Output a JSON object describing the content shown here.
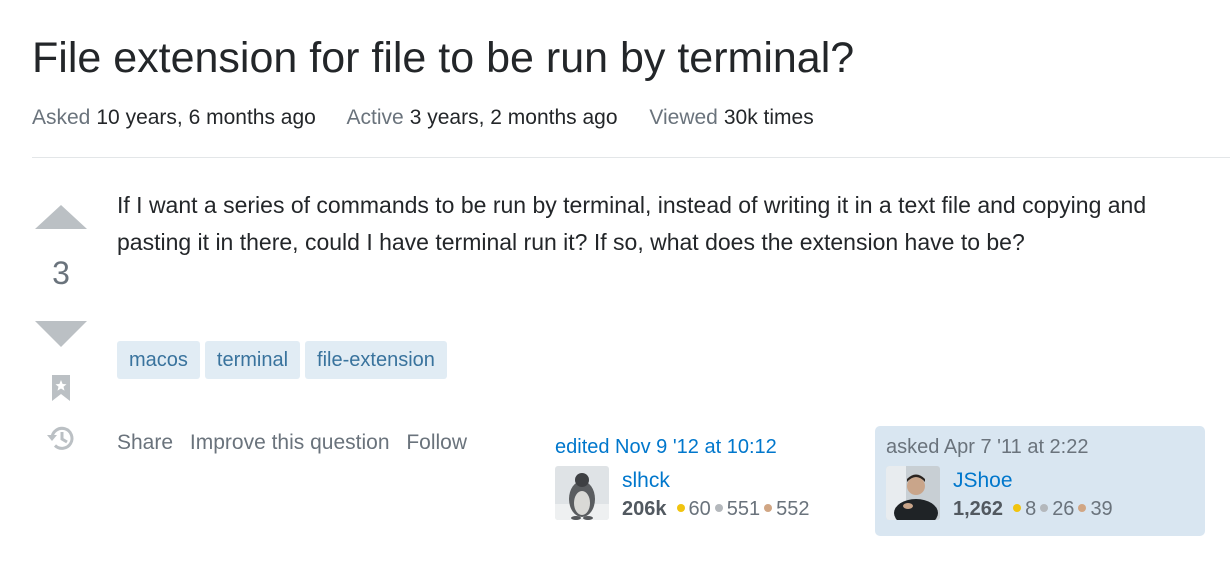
{
  "question": {
    "title": "File extension for file to be run by terminal?",
    "meta": {
      "asked_label": "Asked",
      "asked_value": "10 years, 6 months ago",
      "active_label": "Active",
      "active_value": "3 years, 2 months ago",
      "viewed_label": "Viewed",
      "viewed_value": "30k times"
    },
    "vote_count": "3",
    "body": "If I want a series of commands to be run by terminal, instead of writing it in a text file and copying and pasting it in there, could I have terminal run it? If so, what does the extension have to be?",
    "tags": [
      "macos",
      "terminal",
      "file-extension"
    ],
    "actions": {
      "share": "Share",
      "improve": "Improve this question",
      "follow": "Follow"
    }
  },
  "editor": {
    "edited_text": "edited Nov 9 '12 at 10:12",
    "name": "slhck",
    "reputation": "206k",
    "gold": "60",
    "silver": "551",
    "bronze": "552"
  },
  "asker": {
    "asked_text": "asked Apr 7 '11 at 2:22",
    "name": "JShoe",
    "reputation": "1,262",
    "gold": "8",
    "silver": "26",
    "bronze": "39"
  },
  "colors": {
    "link": "#0077cc",
    "tag_bg": "#e1ecf4",
    "tag_text": "#39739d",
    "owner_bg": "#d9e6f1",
    "vote_arrow": "#bbc0c4"
  },
  "icons": {
    "upvote": "triangle-up",
    "downvote": "triangle-down",
    "bookmark": "bookmark-icon",
    "history": "history-icon"
  }
}
